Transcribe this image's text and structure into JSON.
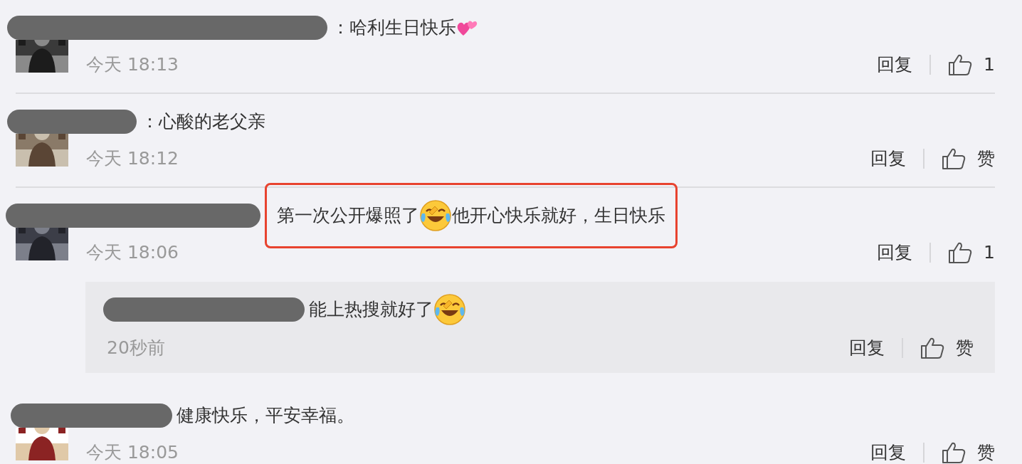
{
  "comments": [
    {
      "avatar": {
        "kind": "picture"
      },
      "redacted": true,
      "highlighted": false,
      "segments": [
        {
          "kind": "text",
          "text": "：哈利生日快乐"
        },
        {
          "kind": "hearts"
        }
      ],
      "time": "今天 18:13",
      "reply": "回复",
      "likes": "1"
    },
    {
      "avatar": {
        "kind": "picture"
      },
      "redacted": true,
      "highlighted": false,
      "segments": [
        {
          "kind": "text",
          "text": "：心酸的老父亲"
        }
      ],
      "time": "今天 18:12",
      "reply": "回复",
      "likes": "赞"
    },
    {
      "avatar": {
        "kind": "picture"
      },
      "redacted": true,
      "highlighted": true,
      "segments": [
        {
          "kind": "text",
          "text": "第一次公开爆照了"
        },
        {
          "kind": "laugh-cry"
        },
        {
          "kind": "text",
          "text": "他开心快乐就好，生日快乐"
        }
      ],
      "time": "今天 18:06",
      "reply": "回复",
      "likes": "1",
      "replies": [
        {
          "redacted": true,
          "highlighted": false,
          "segments": [
            {
              "kind": "text",
              "text": "能上热搜就好了"
            },
            {
              "kind": "laugh-cry"
            }
          ],
          "time": "20秒前",
          "reply": "回复",
          "likes": "赞"
        }
      ]
    },
    {
      "avatar": {
        "kind": "picture"
      },
      "redacted": true,
      "highlighted": false,
      "segments": [
        {
          "kind": "text",
          "text": "健康快乐，平安幸福。"
        }
      ],
      "time": "今天 18:05",
      "reply": "回复",
      "likes": "赞"
    }
  ]
}
